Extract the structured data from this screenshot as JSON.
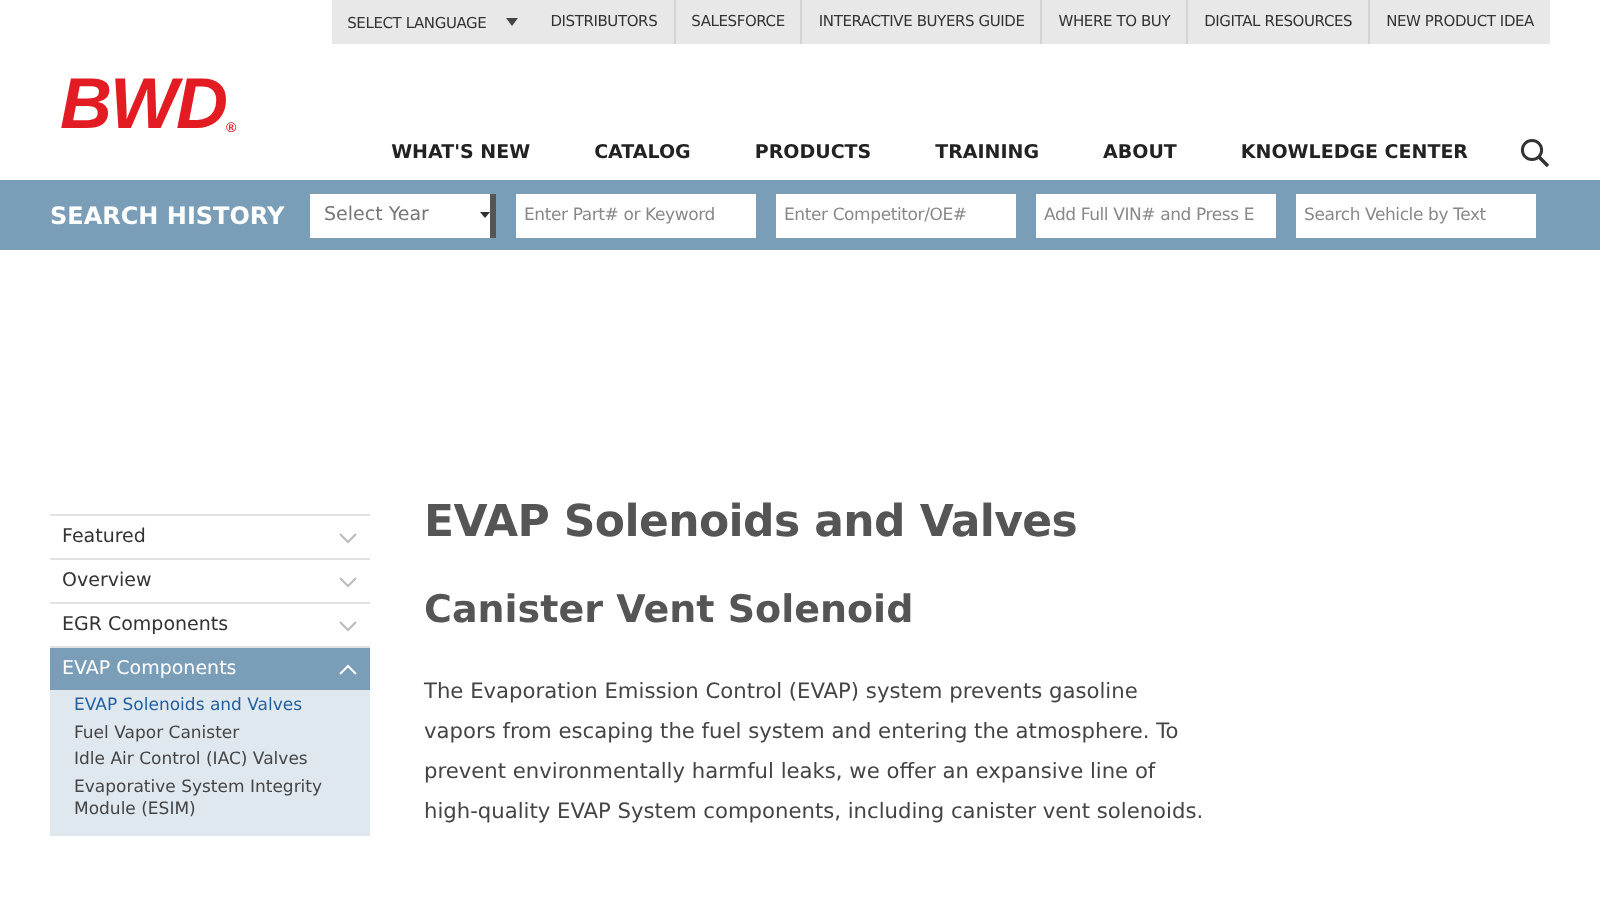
{
  "utility_bar": {
    "language": "SELECT LANGUAGE",
    "links": [
      "DISTRIBUTORS",
      "SALESFORCE",
      "INTERACTIVE BUYERS GUIDE",
      "WHERE TO BUY",
      "DIGITAL RESOURCES",
      "NEW PRODUCT IDEA"
    ]
  },
  "logo": {
    "text": "BWD",
    "mark": "®"
  },
  "nav": [
    "WHAT'S NEW",
    "CATALOG",
    "PRODUCTS",
    "TRAINING",
    "ABOUT",
    "KNOWLEDGE CENTER"
  ],
  "search_bar": {
    "title": "SEARCH HISTORY",
    "year_select": "Select Year",
    "fields": [
      {
        "placeholder": "Enter Part# or Keyword"
      },
      {
        "placeholder": "Enter Competitor/OE#"
      },
      {
        "placeholder": "Add Full VIN# and Press E"
      },
      {
        "placeholder": "Search Vehicle by Text"
      }
    ]
  },
  "sidebar": {
    "sections": [
      {
        "label": "Featured",
        "expanded": false
      },
      {
        "label": "Overview",
        "expanded": false
      },
      {
        "label": "EGR Components",
        "expanded": false
      },
      {
        "label": "EVAP Components",
        "expanded": true,
        "children": [
          {
            "label": "EVAP Solenoids and Valves",
            "selected": true
          },
          {
            "label": "Fuel Vapor Canister",
            "selected": false
          },
          {
            "label": "Idle Air Control (IAC) Valves",
            "selected": false
          },
          {
            "label": "Evaporative System Integrity Module (ESIM)",
            "selected": false
          }
        ]
      }
    ]
  },
  "content": {
    "title": "EVAP Solenoids and Valves",
    "subtitle": "Canister Vent Solenoid",
    "body": "The Evaporation Emission Control (EVAP) system prevents gasoline vapors from escaping the fuel system and entering the atmosphere. To prevent environmentally harmful leaks, we offer an expansive line of high-quality EVAP System components, including canister vent solenoids."
  }
}
